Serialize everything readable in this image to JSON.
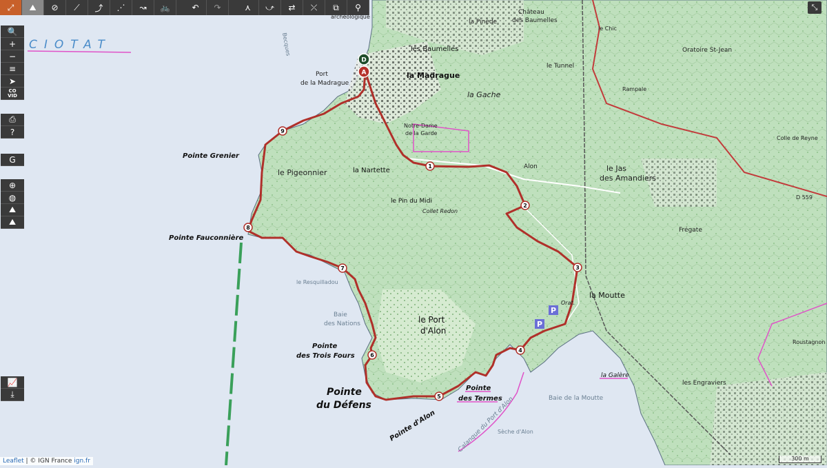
{
  "toolbar": {
    "buttons": [
      {
        "name": "fullscreen-map-button",
        "icon": "⤢"
      },
      {
        "name": "hiker-button",
        "icon": "⛰"
      },
      {
        "name": "hide-route-button",
        "icon": "⊘"
      },
      {
        "name": "draw-line-button",
        "icon": "⟋"
      },
      {
        "name": "draw-segment-button",
        "icon": "⤴"
      },
      {
        "name": "add-point-button",
        "icon": "⋰"
      },
      {
        "name": "route-edit-button",
        "icon": "↝"
      },
      {
        "name": "bike-button",
        "icon": "🚲"
      },
      {
        "name": "undo-button",
        "icon": "↶"
      },
      {
        "name": "redo-button",
        "icon": "↷"
      },
      {
        "name": "split-button",
        "icon": "⋏"
      },
      {
        "name": "merge-button",
        "icon": "⤻"
      },
      {
        "name": "reverse-button",
        "icon": "⇄"
      },
      {
        "name": "no-edit-button",
        "icon": "⤫"
      },
      {
        "name": "copy-button",
        "icon": "⧉"
      },
      {
        "name": "marker-button",
        "icon": "⚲"
      }
    ]
  },
  "sidebar": {
    "group1": [
      {
        "name": "search-button",
        "icon": "🔍"
      },
      {
        "name": "zoom-in-button",
        "icon": "+"
      },
      {
        "name": "zoom-out-button",
        "icon": "−"
      },
      {
        "name": "layers-button",
        "icon": "≡"
      },
      {
        "name": "locate-button",
        "icon": "➤"
      },
      {
        "name": "covid-button",
        "icon": "CO VID"
      }
    ],
    "group2": [
      {
        "name": "print-button",
        "icon": "⎙"
      },
      {
        "name": "help-button",
        "icon": "?"
      }
    ],
    "group3": [
      {
        "name": "google-button",
        "icon": "G"
      }
    ],
    "group4": [
      {
        "name": "center-button",
        "icon": "⊕"
      },
      {
        "name": "globe-button",
        "icon": "◍"
      },
      {
        "name": "elevation-button",
        "icon": "⛰"
      },
      {
        "name": "terrain-button",
        "icon": "⛰"
      }
    ],
    "group5": [
      {
        "name": "profile-chart-button",
        "icon": "📈"
      },
      {
        "name": "download-button",
        "icon": "⤓"
      }
    ]
  },
  "fullscreen_icon": "⤡",
  "attribution": {
    "leaflet": "Leaflet",
    "sep": " | © IGN France ",
    "ign": "ign.fr"
  },
  "scale": {
    "label": "300 m"
  },
  "labels": {
    "ciotat": "CIOTAT",
    "pointe_grenier": "Pointe Grenier",
    "pointe_fauconniere": "Pointe Fauconnière",
    "port_madrague_1": "Port",
    "port_madrague_2": "de la Madrague",
    "la_madrague": "la Madrague",
    "la_gache": "la Gache",
    "les_baumelles": "les Baumelles",
    "chateau_1": "Château",
    "chateau_2": "des Baumelles",
    "la_pinede": "la Pinède",
    "le_tunnel": "le Tunnel",
    "oratoire": "Oratoire St-Jean",
    "le_pigeonnier": "le Pigeonnier",
    "la_nartette": "la Nartette",
    "le_pin_du_midi": "le Pin du Midi",
    "collet_redon": "Collet Redon",
    "notre_dame_1": "Notre-Dame",
    "notre_dame_2": "de la Garde",
    "alon": "Alon",
    "le_jas_1": "le Jas",
    "le_jas_2": "des Amandiers",
    "fregate": "Frégate",
    "la_moutte": "la Moutte",
    "le_port_1": "le Port",
    "le_port_2": "d'Alon",
    "baie_nations_1": "Baie",
    "baie_nations_2": "des Nations",
    "le_resquilladou": "le Resquilladou",
    "trois_fours_1": "Pointe",
    "trois_fours_2": "des Trois Fours",
    "defens_1": "Pointe",
    "defens_2": "du Défens",
    "pointe_alon": "Pointe d'Alon",
    "termes_1": "Pointe",
    "termes_2": "des Termes",
    "calanque": "Calanque du Port d'Alon",
    "seche": "Sèche d'Alon",
    "baie_moutte": "Baie de la Moutte",
    "la_galere": "la Galère",
    "les_engraviers": "les Engraviers",
    "rustagnon": "Roustagnon",
    "rampale": "Rampale",
    "d559": "D 559",
    "colle_reyne": "Colle de Reyne",
    "le_chic": "le Chic",
    "archeo": "archéologique",
    "becques": "Becques",
    "orat": "Orat."
  },
  "route_points": [
    {
      "label": "D",
      "color": "#1f4d2a"
    },
    {
      "label": "A",
      "color": "#b5312a"
    },
    {
      "label": "1"
    },
    {
      "label": "2"
    },
    {
      "label": "3"
    },
    {
      "label": "4"
    },
    {
      "label": "5"
    },
    {
      "label": "6"
    },
    {
      "label": "7"
    },
    {
      "label": "8"
    },
    {
      "label": "9"
    }
  ],
  "colors": {
    "sea": "#dfe7f2",
    "land": "#cfe6cf",
    "forest": "#a9d3a3",
    "route": "#b0302a",
    "border": "#e052c8",
    "maritime_limit": "#3aa05a",
    "toolbar": "#3a3a3a",
    "accent": "#c8602a"
  }
}
